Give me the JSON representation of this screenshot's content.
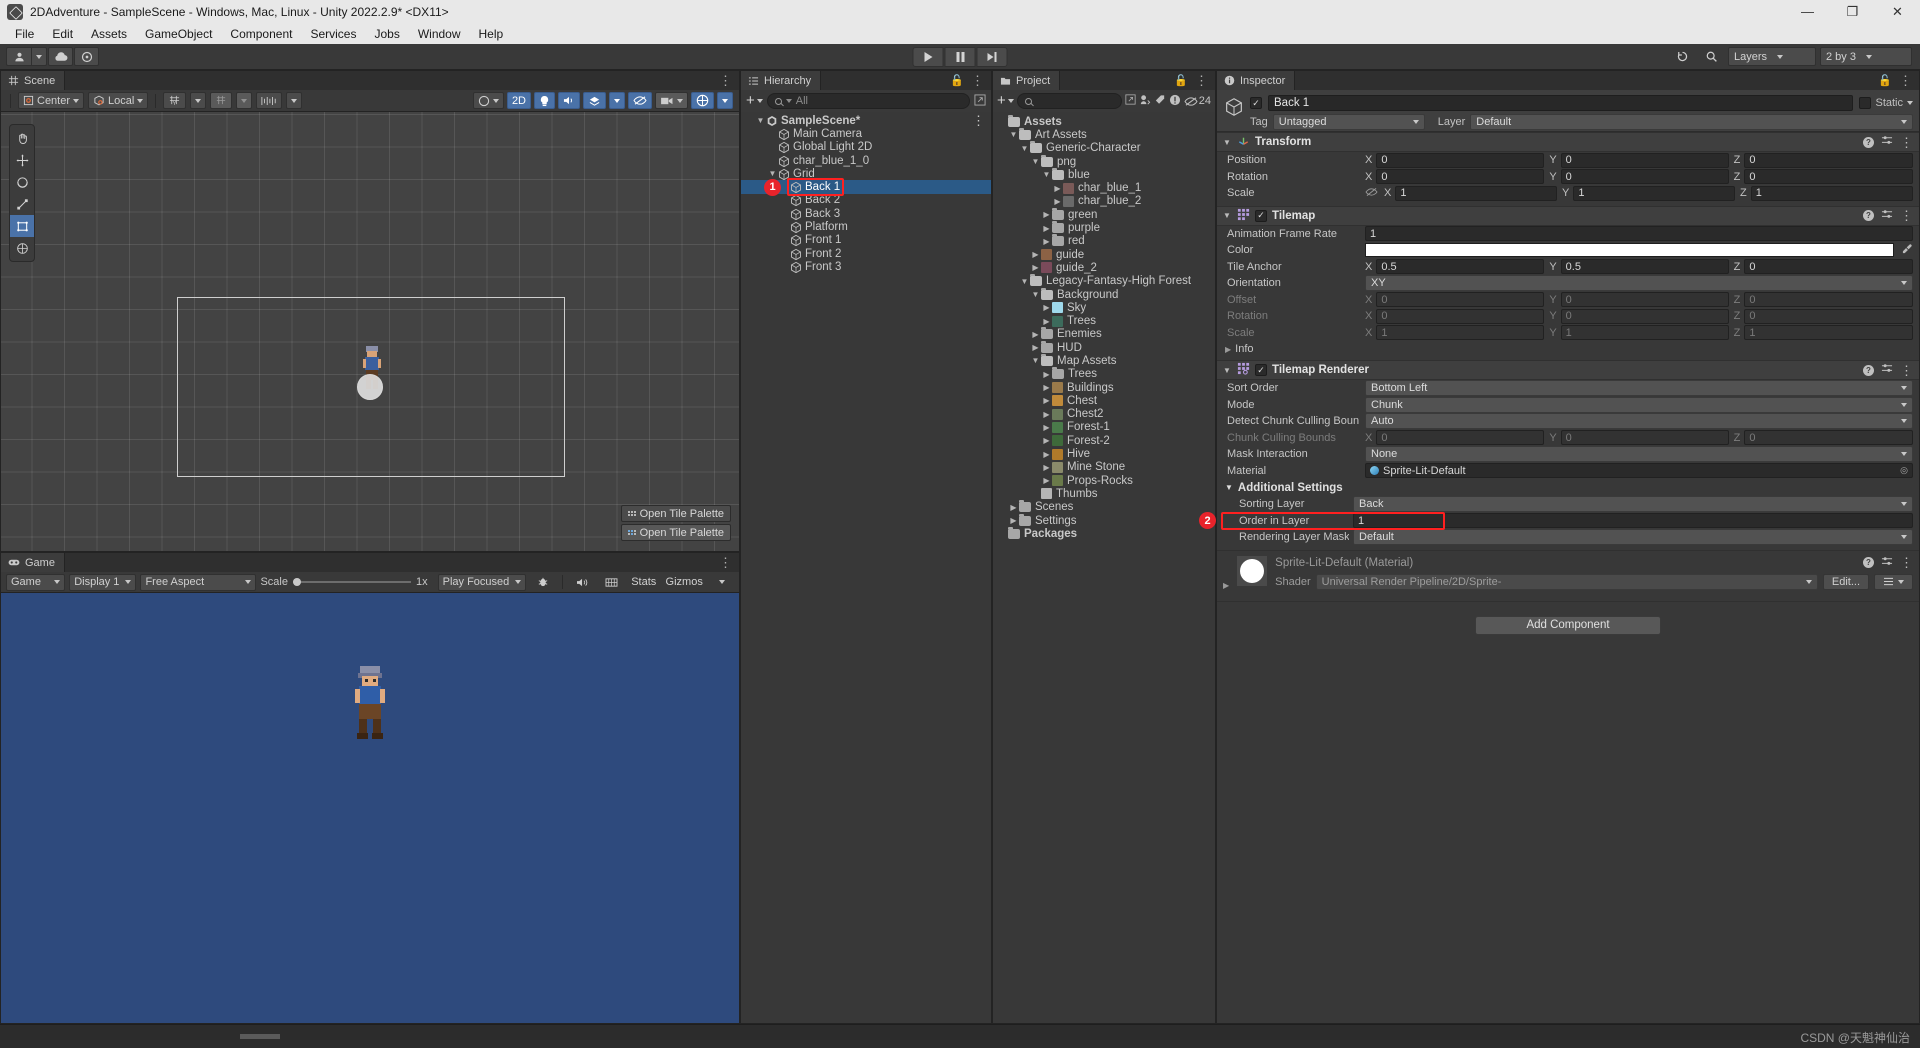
{
  "window": {
    "title": "2DAdventure - SampleScene - Windows, Mac, Linux - Unity 2022.2.9* <DX11>",
    "minimize": "—",
    "maximize": "❐",
    "close": "✕"
  },
  "menubar": {
    "items": [
      "File",
      "Edit",
      "Assets",
      "GameObject",
      "Component",
      "Services",
      "Jobs",
      "Window",
      "Help"
    ]
  },
  "toolbar": {
    "account_icon": "account-icon",
    "cloud_icon": "cloud-icon",
    "collab_icon": "collab-icon",
    "play_icon": "play-icon",
    "pause_icon": "pause-icon",
    "step_icon": "step-icon",
    "undo_history_icon": "undo-history-icon",
    "search_icon": "search-icon",
    "layers_label": "Layers",
    "layout_label": "2 by 3"
  },
  "scene": {
    "tab_label": "Scene",
    "pivot_label": "Center",
    "space_label": "Local",
    "grid_label": "grid-visibility",
    "snap_label": "grid-snapping",
    "tool_settings_label": "tool-settings",
    "shaded_label": "shading-mode",
    "two_d_label": "2D",
    "tools": [
      "hand-tool",
      "move-tool",
      "rotate-tool",
      "scale-tool",
      "rect-tool",
      "transform-tool"
    ],
    "tile_palette_btn_1": "Open Tile Palette",
    "tile_palette_btn_2": "Open Tile Palette"
  },
  "game": {
    "tab_label": "Game",
    "display_mode": "Game",
    "display": "Display 1",
    "aspect": "Free Aspect",
    "scale_label": "Scale",
    "scale_value": "1x",
    "play_mode": "Play Focused",
    "stats_label": "Stats",
    "gizmos_label": "Gizmos",
    "mute_icon": "mute-audio-icon",
    "stats_icon": "stats-icon",
    "bug_icon": "bug-icon",
    "background_color": "#2e4a7d"
  },
  "hierarchy": {
    "tab_label": "Hierarchy",
    "add_label": "+",
    "search_placeholder": "All",
    "items": [
      {
        "label": "SampleScene*",
        "depth": 0,
        "twist": "open",
        "icon": "unity-scene-icon",
        "selected": false
      },
      {
        "label": "Main Camera",
        "depth": 1,
        "twist": "none",
        "icon": "gameobject-icon",
        "selected": false
      },
      {
        "label": "Global Light 2D",
        "depth": 1,
        "twist": "none",
        "icon": "gameobject-icon",
        "selected": false
      },
      {
        "label": "char_blue_1_0",
        "depth": 1,
        "twist": "none",
        "icon": "gameobject-icon",
        "selected": false
      },
      {
        "label": "Grid",
        "depth": 1,
        "twist": "open",
        "icon": "gameobject-icon",
        "selected": false
      },
      {
        "label": "Back 1",
        "depth": 2,
        "twist": "none",
        "icon": "gameobject-icon",
        "selected": true
      },
      {
        "label": "Back 2",
        "depth": 2,
        "twist": "none",
        "icon": "gameobject-icon",
        "selected": false
      },
      {
        "label": "Back 3",
        "depth": 2,
        "twist": "none",
        "icon": "gameobject-icon",
        "selected": false
      },
      {
        "label": "Platform",
        "depth": 2,
        "twist": "none",
        "icon": "gameobject-icon",
        "selected": false
      },
      {
        "label": "Front 1",
        "depth": 2,
        "twist": "none",
        "icon": "gameobject-icon",
        "selected": false
      },
      {
        "label": "Front 2",
        "depth": 2,
        "twist": "none",
        "icon": "gameobject-icon",
        "selected": false
      },
      {
        "label": "Front 3",
        "depth": 2,
        "twist": "none",
        "icon": "gameobject-icon",
        "selected": false
      }
    ]
  },
  "project": {
    "tab_label": "Project",
    "search_placeholder": "",
    "badge_count": "24",
    "items": [
      {
        "label": "Assets",
        "depth": 0,
        "twist": "none",
        "icon": "folder-open",
        "bold": true
      },
      {
        "label": "Art Assets",
        "depth": 1,
        "twist": "open",
        "icon": "folder-open"
      },
      {
        "label": "Generic-Character",
        "depth": 2,
        "twist": "open",
        "icon": "folder-open"
      },
      {
        "label": "png",
        "depth": 3,
        "twist": "open",
        "icon": "folder-open"
      },
      {
        "label": "blue",
        "depth": 4,
        "twist": "open",
        "icon": "folder-open"
      },
      {
        "label": "char_blue_1",
        "depth": 5,
        "twist": "closed",
        "icon": "sprite-asset",
        "color": "#7a5a58"
      },
      {
        "label": "char_blue_2",
        "depth": 5,
        "twist": "closed",
        "icon": "sprite-asset",
        "color": "#6a6a6a"
      },
      {
        "label": "green",
        "depth": 4,
        "twist": "closed",
        "icon": "folder"
      },
      {
        "label": "purple",
        "depth": 4,
        "twist": "closed",
        "icon": "folder"
      },
      {
        "label": "red",
        "depth": 4,
        "twist": "closed",
        "icon": "folder"
      },
      {
        "label": "guide",
        "depth": 3,
        "twist": "closed",
        "icon": "sprite-asset",
        "color": "#8c6245"
      },
      {
        "label": "guide_2",
        "depth": 3,
        "twist": "closed",
        "icon": "sprite-asset",
        "color": "#7a4a5a"
      },
      {
        "label": "Legacy-Fantasy-High Forest",
        "depth": 2,
        "twist": "open",
        "icon": "folder-open"
      },
      {
        "label": "Background",
        "depth": 3,
        "twist": "open",
        "icon": "folder-open"
      },
      {
        "label": "Sky",
        "depth": 4,
        "twist": "closed",
        "icon": "sprite-asset",
        "color": "#9fd9ec"
      },
      {
        "label": "Trees",
        "depth": 4,
        "twist": "closed",
        "icon": "sprite-asset",
        "color": "#3c6b5c"
      },
      {
        "label": "Enemies",
        "depth": 3,
        "twist": "closed",
        "icon": "folder"
      },
      {
        "label": "HUD",
        "depth": 3,
        "twist": "closed",
        "icon": "folder"
      },
      {
        "label": "Map Assets",
        "depth": 3,
        "twist": "open",
        "icon": "folder-open"
      },
      {
        "label": "Trees",
        "depth": 4,
        "twist": "closed",
        "icon": "folder"
      },
      {
        "label": "Buildings",
        "depth": 4,
        "twist": "closed",
        "icon": "sprite-asset",
        "color": "#9a7a4a"
      },
      {
        "label": "Chest",
        "depth": 4,
        "twist": "closed",
        "icon": "sprite-asset",
        "color": "#c08a3a"
      },
      {
        "label": "Chest2",
        "depth": 4,
        "twist": "closed",
        "icon": "sprite-asset",
        "color": "#6a7a5a"
      },
      {
        "label": "Forest-1",
        "depth": 4,
        "twist": "closed",
        "icon": "sprite-asset",
        "color": "#4a7a4a"
      },
      {
        "label": "Forest-2",
        "depth": 4,
        "twist": "closed",
        "icon": "sprite-asset",
        "color": "#3e6a3a"
      },
      {
        "label": "Hive",
        "depth": 4,
        "twist": "closed",
        "icon": "sprite-asset",
        "color": "#b07a2a"
      },
      {
        "label": "Mine Stone",
        "depth": 4,
        "twist": "closed",
        "icon": "sprite-asset",
        "color": "#8a8a6a"
      },
      {
        "label": "Props-Rocks",
        "depth": 4,
        "twist": "closed",
        "icon": "sprite-asset",
        "color": "#6a7a4a"
      },
      {
        "label": "Thumbs",
        "depth": 3,
        "twist": "none",
        "icon": "file-asset",
        "color": "#b5b5b5"
      },
      {
        "label": "Scenes",
        "depth": 1,
        "twist": "closed",
        "icon": "folder"
      },
      {
        "label": "Settings",
        "depth": 1,
        "twist": "closed",
        "icon": "folder"
      },
      {
        "label": "Packages",
        "depth": 0,
        "twist": "none",
        "icon": "folder",
        "bold": true
      }
    ]
  },
  "inspector": {
    "tab_label": "Inspector",
    "object_name": "Back 1",
    "enabled": true,
    "static_label": "Static",
    "tag_label": "Tag",
    "tag_value": "Untagged",
    "layer_label": "Layer",
    "layer_value": "Default",
    "transform": {
      "title": "Transform",
      "rows": [
        {
          "label": "Position",
          "x": "0",
          "y": "0",
          "z": "0",
          "dim": false,
          "hidden_icon": false
        },
        {
          "label": "Rotation",
          "x": "0",
          "y": "0",
          "z": "0",
          "dim": false,
          "hidden_icon": false
        },
        {
          "label": "Scale",
          "x": "1",
          "y": "1",
          "z": "1",
          "dim": false,
          "hidden_icon": true
        }
      ]
    },
    "tilemap": {
      "title": "Tilemap",
      "enabled": true,
      "animation_frame_rate_label": "Animation Frame Rate",
      "animation_frame_rate_value": "1",
      "color_label": "Color",
      "color_value": "#ffffff",
      "tile_anchor_label": "Tile Anchor",
      "tile_anchor": {
        "x": "0.5",
        "y": "0.5",
        "z": "0"
      },
      "orientation_label": "Orientation",
      "orientation_value": "XY",
      "offset_label": "Offset",
      "offset": {
        "x": "0",
        "y": "0",
        "z": "0"
      },
      "rotation_label": "Rotation",
      "rotation": {
        "x": "0",
        "y": "0",
        "z": "0"
      },
      "scale_label": "Scale",
      "scale": {
        "x": "1",
        "y": "1",
        "z": "1"
      },
      "info_label": "Info"
    },
    "tilemap_renderer": {
      "title": "Tilemap Renderer",
      "enabled": true,
      "sort_order_label": "Sort Order",
      "sort_order_value": "Bottom Left",
      "mode_label": "Mode",
      "mode_value": "Chunk",
      "detect_bounds_label": "Detect Chunk Culling Boun",
      "detect_bounds_value": "Auto",
      "culling_bounds_label": "Chunk Culling Bounds",
      "culling_bounds": {
        "x": "0",
        "y": "0",
        "z": "0"
      },
      "mask_interaction_label": "Mask Interaction",
      "mask_interaction_value": "None",
      "material_label": "Material",
      "material_value": "Sprite-Lit-Default",
      "additional_settings_label": "Additional Settings",
      "sorting_layer_label": "Sorting Layer",
      "sorting_layer_value": "Back",
      "order_in_layer_label": "Order in Layer",
      "order_in_layer_value": "1",
      "rendering_layer_mask_label": "Rendering Layer Mask",
      "rendering_layer_mask_value": "Default"
    },
    "material_block": {
      "title": "Sprite-Lit-Default (Material)",
      "shader_label": "Shader",
      "shader_value": "Universal Render Pipeline/2D/Sprite-",
      "edit_label": "Edit..."
    },
    "add_component_label": "Add Component"
  },
  "annotations": [
    {
      "id": "1",
      "target": "hierarchy-back-1"
    },
    {
      "id": "2",
      "target": "order-in-layer"
    }
  ],
  "statusbar": {
    "watermark": "CSDN @天魁神仙治"
  },
  "colors": {
    "accent_selection": "#2b5a87",
    "highlight_red": "#ff2020",
    "badge_red": "#e8232b",
    "panel_bg": "#383838",
    "toolbar_bg": "#393939"
  }
}
